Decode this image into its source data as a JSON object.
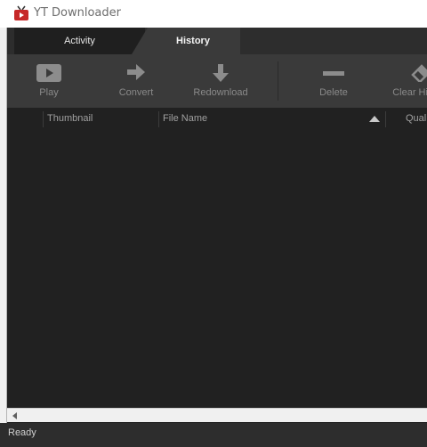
{
  "window": {
    "title": "YT Downloader",
    "app_icon": "tv-icon"
  },
  "tabs": [
    {
      "label": "Activity",
      "active": false
    },
    {
      "label": "History",
      "active": true
    }
  ],
  "toolbar": {
    "play_label": "Play",
    "convert_label": "Convert",
    "redownload_label": "Redownload",
    "delete_label": "Delete",
    "clear_history_label": "Clear History"
  },
  "table": {
    "columns": [
      "Thumbnail",
      "File Name",
      "Quality"
    ],
    "sort_column": "File Name",
    "sort_direction": "ascending",
    "rows": []
  },
  "status": {
    "text": "Ready"
  },
  "colors": {
    "background": "#212121",
    "toolbar": "#3a3a3a",
    "accent_icon": "#c62828"
  }
}
